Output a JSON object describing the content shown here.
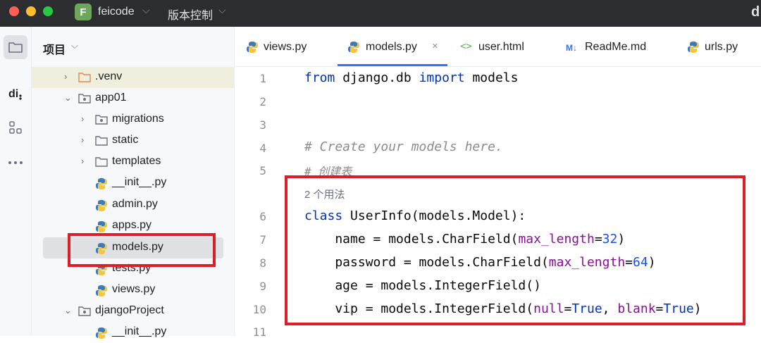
{
  "titlebar": {
    "project_badge": "F",
    "project_name": "feicode",
    "vcs_label": "版本控制",
    "right_glyph": "d"
  },
  "activity_bar": {
    "items": [
      "folder-icon",
      "di-icon",
      "structure-icon",
      "more-icon"
    ]
  },
  "project_panel": {
    "title": "项目",
    "tree": [
      {
        "label": ".venv",
        "type": "folder",
        "expanded": false
      },
      {
        "label": "app01",
        "type": "package",
        "expanded": true
      },
      {
        "label": "migrations",
        "type": "package",
        "expanded": false
      },
      {
        "label": "static",
        "type": "folder",
        "expanded": false
      },
      {
        "label": "templates",
        "type": "folder",
        "expanded": false
      },
      {
        "label": "__init__.py",
        "type": "python"
      },
      {
        "label": "admin.py",
        "type": "python"
      },
      {
        "label": "apps.py",
        "type": "python"
      },
      {
        "label": "models.py",
        "type": "python",
        "selected": true
      },
      {
        "label": "tests.py",
        "type": "python"
      },
      {
        "label": "views.py",
        "type": "python"
      },
      {
        "label": "djangoProject",
        "type": "package",
        "expanded": true
      },
      {
        "label": "__init__.py",
        "type": "python"
      }
    ]
  },
  "editor": {
    "tabs": [
      {
        "label": "views.py",
        "icon": "python-icon"
      },
      {
        "label": "models.py",
        "icon": "python-icon",
        "active": true
      },
      {
        "label": "user.html",
        "icon": "html-icon"
      },
      {
        "label": "ReadMe.md",
        "icon": "markdown-icon",
        "badge": "M↓"
      },
      {
        "label": "urls.py",
        "icon": "python-icon"
      }
    ],
    "close_glyph": "×",
    "line_numbers": [
      "1",
      "2",
      "3",
      "4",
      "5",
      "6",
      "7",
      "8",
      "9",
      "10",
      "11"
    ],
    "usage_hint": "2 个用法",
    "code": {
      "l1_kw1": "from",
      "l1_mid": " django.db ",
      "l1_kw2": "import",
      "l1_end": " models",
      "l4": "# Create your models here.",
      "l5": "# 创建表",
      "l6_kw": "class",
      "l6_rest": " UserInfo(models.Model):",
      "l7_a": "    name = models.CharField(",
      "l7_k": "max_length",
      "l7_eq": "=",
      "l7_n": "32",
      "l7_e": ")",
      "l8_a": "    password = models.CharField(",
      "l8_k": "max_length",
      "l8_eq": "=",
      "l8_n": "64",
      "l8_e": ")",
      "l9": "    age = models.IntegerField()",
      "l10_a": "    vip = models.IntegerField(",
      "l10_k1": "null",
      "l10_eq1": "=",
      "l10_v1": "True",
      "l10_c": ", ",
      "l10_k2": "blank",
      "l10_eq2": "=",
      "l10_v2": "True",
      "l10_e": ")"
    }
  },
  "colors": {
    "highlight_box": "#dc1f26",
    "keyword": "#0033b3",
    "accent": "#3574f0"
  }
}
